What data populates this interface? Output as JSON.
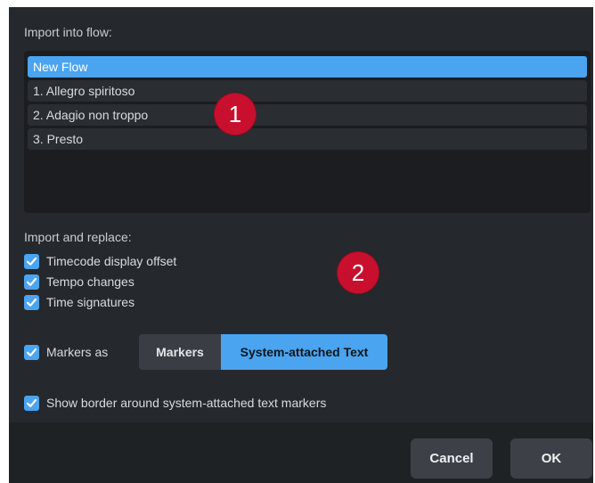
{
  "import_section": {
    "label": "Import into flow:",
    "flows": [
      {
        "label": "New Flow",
        "selected": true
      },
      {
        "label": "1. Allegro spiritoso",
        "selected": false
      },
      {
        "label": "2. Adagio non troppo",
        "selected": false
      },
      {
        "label": "3. Presto",
        "selected": false
      }
    ]
  },
  "badges": {
    "one": "1",
    "two": "2"
  },
  "replace_section": {
    "label": "Import and replace:",
    "options": [
      {
        "label": "Timecode display offset",
        "checked": true
      },
      {
        "label": "Tempo changes",
        "checked": true
      },
      {
        "label": "Time signatures",
        "checked": true
      }
    ]
  },
  "markers": {
    "checkbox_label": "Markers as",
    "checked": true,
    "options": [
      "Markers",
      "System-attached Text"
    ],
    "selected": "System-attached Text"
  },
  "border_option": {
    "label": "Show border around system-attached text markers",
    "checked": true
  },
  "footer": {
    "cancel_label": "Cancel",
    "ok_label": "OK"
  },
  "colors": {
    "background": "#25282c",
    "accent": "#4aa4f0",
    "badge": "#c8102e"
  }
}
